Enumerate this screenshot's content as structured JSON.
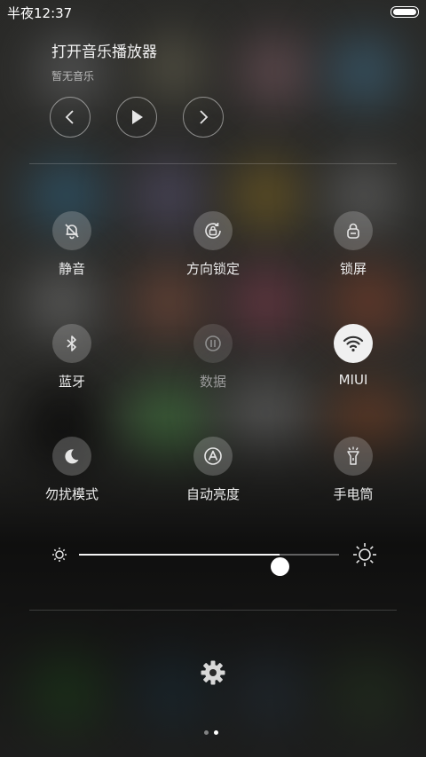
{
  "status_bar": {
    "time": "半夜12:37"
  },
  "music": {
    "title": "打开音乐播放器",
    "subtitle": "暂无音乐",
    "prev_icon": "chevron-left-icon",
    "play_icon": "play-icon",
    "next_icon": "chevron-right-icon"
  },
  "toggles": [
    {
      "label": "静音",
      "icon": "bell-mute-icon",
      "active": false,
      "enabled": true
    },
    {
      "label": "方向锁定",
      "icon": "rotation-lock-icon",
      "active": false,
      "enabled": true
    },
    {
      "label": "锁屏",
      "icon": "lock-icon",
      "active": false,
      "enabled": true
    },
    {
      "label": "蓝牙",
      "icon": "bluetooth-icon",
      "active": false,
      "enabled": true
    },
    {
      "label": "数据",
      "icon": "mobile-data-icon",
      "active": false,
      "enabled": false
    },
    {
      "label": "MIUI",
      "icon": "wifi-icon",
      "active": true,
      "enabled": true
    },
    {
      "label": "勿扰模式",
      "icon": "moon-icon",
      "active": false,
      "enabled": true
    },
    {
      "label": "自动亮度",
      "icon": "auto-brightness-icon",
      "active": false,
      "enabled": true
    },
    {
      "label": "手电筒",
      "icon": "flashlight-icon",
      "active": false,
      "enabled": true
    }
  ],
  "brightness": {
    "level_percent": 77
  },
  "settings": {
    "icon": "gear-icon"
  },
  "pager": {
    "pages": 2,
    "active": 2
  },
  "colors": {
    "active_toggle": "#f0f0f0",
    "text": "#ececec",
    "disabled_text": "#9a9a9a"
  }
}
